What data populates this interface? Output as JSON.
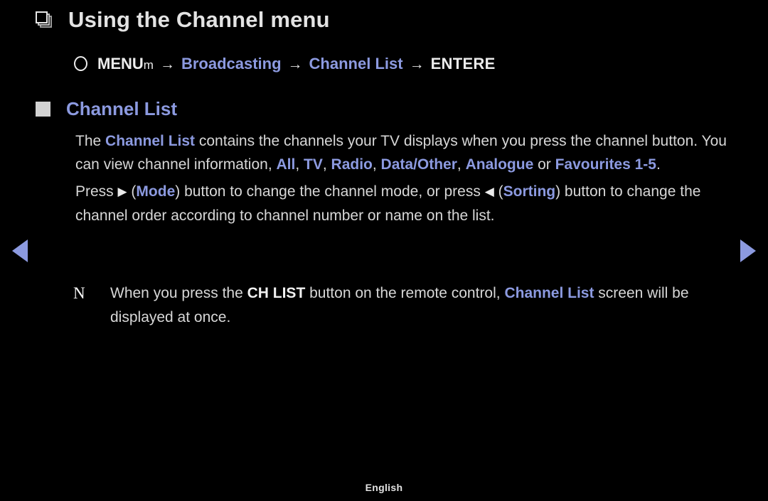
{
  "screen": {
    "background_color": "#000000",
    "text_color": "#d7d7d7",
    "accent_color": "#8c9ae0"
  },
  "title": {
    "bullet_icon": "stacked-square-outline-icon",
    "text": "Using the Channel menu"
  },
  "menu_path": {
    "circle_icon": "remote-circle-button-icon",
    "menu_label": "MENU",
    "menu_suffix": "m",
    "arrow": "→",
    "step_broadcasting": "Broadcasting",
    "step_channel_list": "Channel List",
    "enter_label": "ENTERE"
  },
  "section": {
    "bullet_icon": "filled-square-icon",
    "heading": "Channel List"
  },
  "body": {
    "p1": {
      "t1": "The ",
      "k1": "Channel List",
      "t2": " contains the channels your TV displays when you press the channel button. You can view channel information, ",
      "k2": "All",
      "t3": ", ",
      "k3": "TV",
      "t4": ", ",
      "k4": "Radio",
      "t5": ", ",
      "k5": "Data/Other",
      "t6": ", ",
      "k6": "Analogue",
      "t7": " or ",
      "k7": "Favourites 1-5",
      "t8": "."
    },
    "p2": {
      "t1": "Press ",
      "icon_right": "▶",
      "t2": " (",
      "k1": "Mode",
      "t3": ") button to change the channel mode, or press ",
      "icon_left": "◀",
      "t4": " (",
      "k2": "Sorting",
      "t5": ") button to change the channel order according to channel number or name on the list."
    }
  },
  "note": {
    "glyph": "N",
    "t1": "When you press the ",
    "k1": "CH LIST",
    "t2": " button on the remote control, ",
    "k2": "Channel List",
    "t3": " screen will be displayed at once."
  },
  "navigation": {
    "prev_icon": "left-triangle-arrow-icon",
    "next_icon": "right-triangle-arrow-icon",
    "arrow_color": "#8c9ae0"
  },
  "footer": {
    "language": "English"
  }
}
